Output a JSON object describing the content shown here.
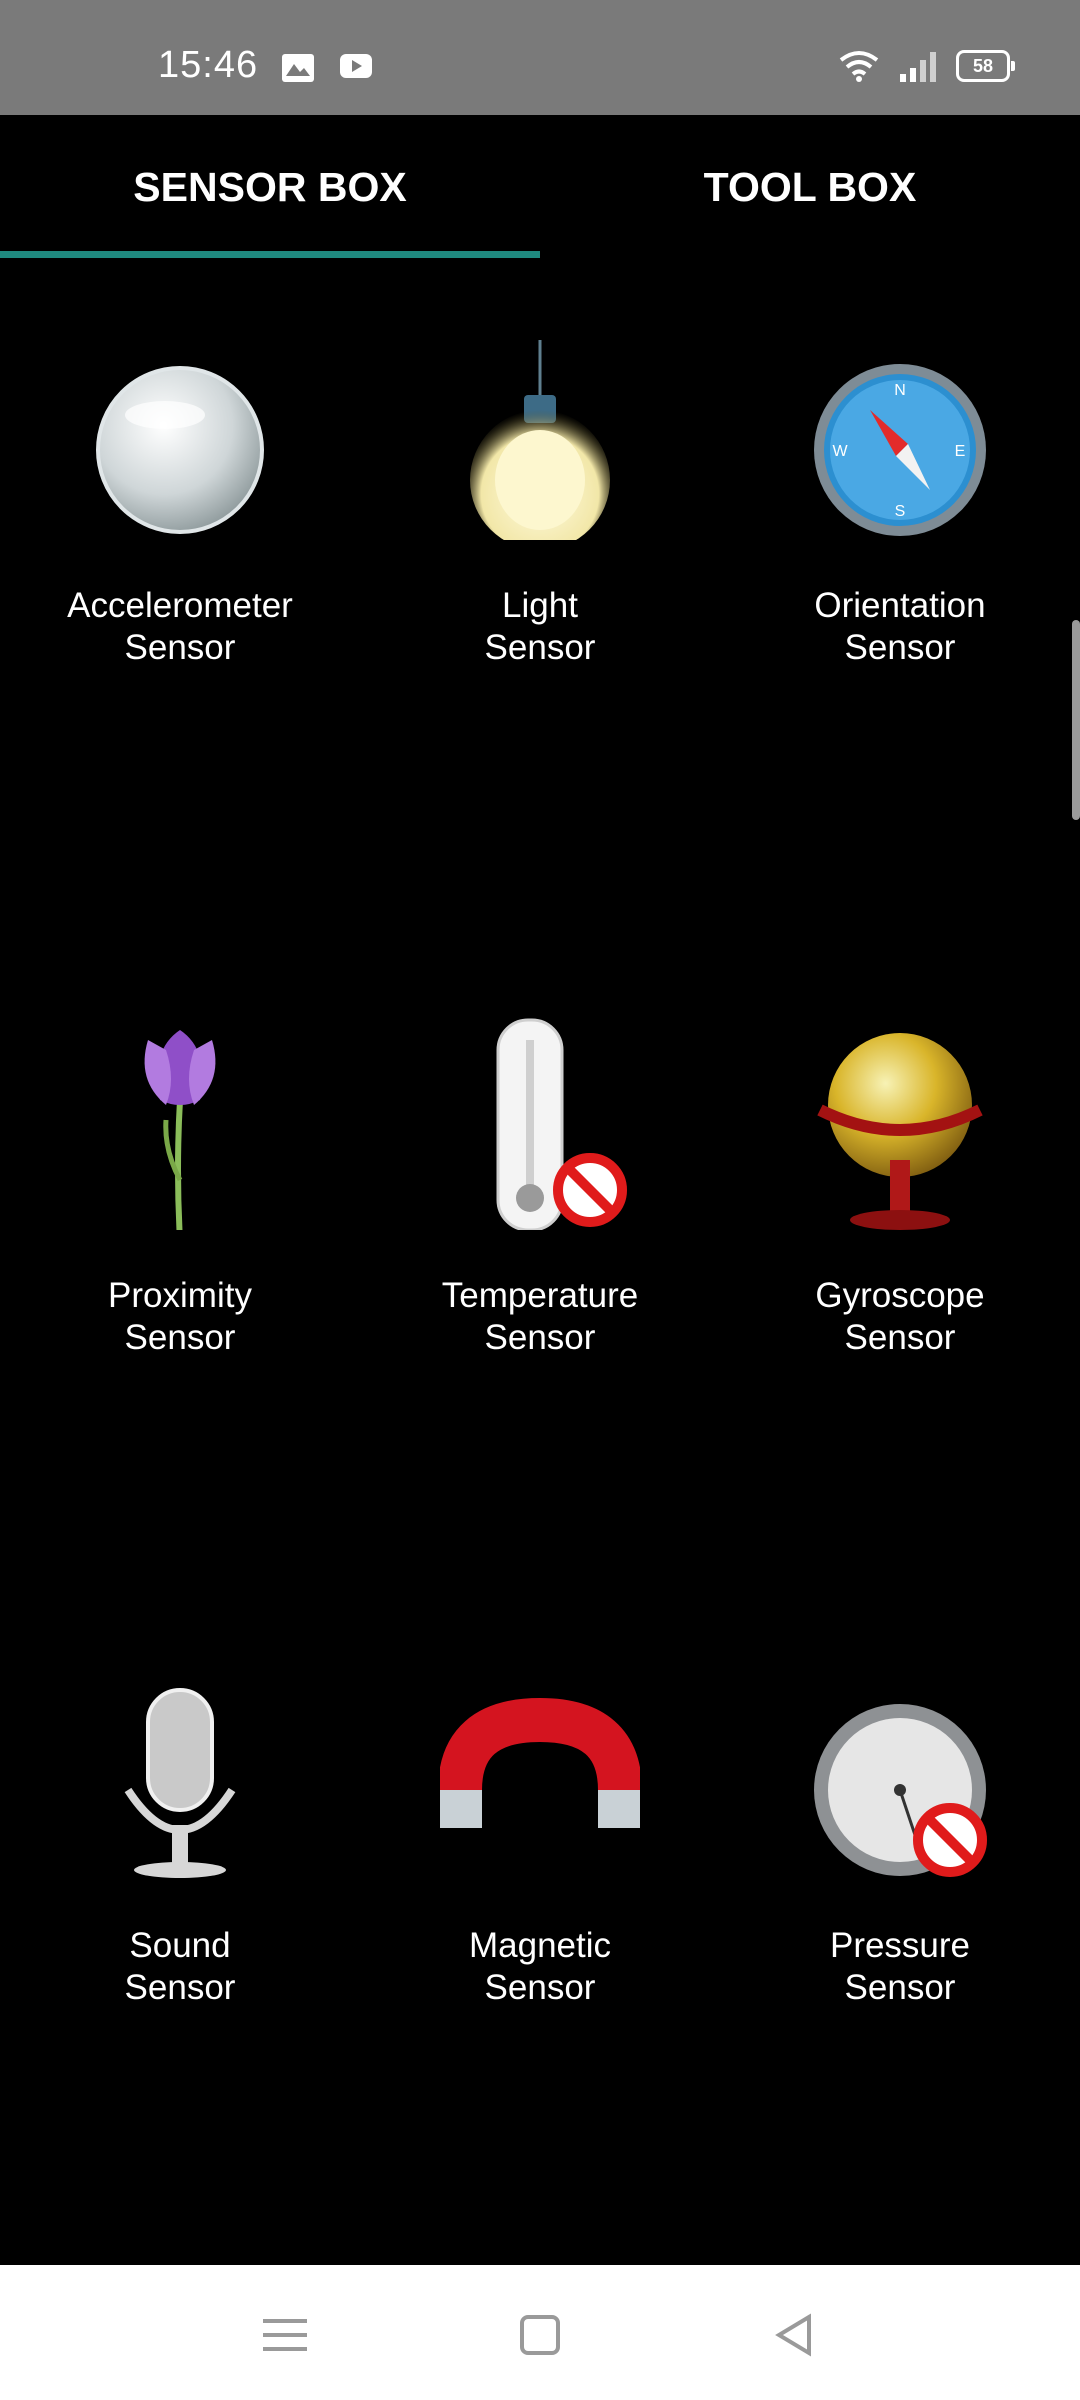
{
  "status_bar": {
    "time": "15:46",
    "left_icons": [
      "gallery-icon",
      "youtube-icon"
    ],
    "right_icons": [
      "wifi-icon",
      "signal-icon"
    ],
    "battery": "58"
  },
  "tabs": [
    {
      "label": "SENSOR BOX",
      "selected": true
    },
    {
      "label": "TOOL BOX",
      "selected": false
    }
  ],
  "accent_color": "#1f8a7f",
  "sensors": [
    {
      "label": "Accelerometer\nSensor",
      "icon": "bubble-icon"
    },
    {
      "label": "Light\nSensor",
      "icon": "lightbulb-icon"
    },
    {
      "label": "Orientation\nSensor",
      "icon": "compass-icon"
    },
    {
      "label": "Proximity\nSensor",
      "icon": "flower-icon"
    },
    {
      "label": "Temperature\nSensor",
      "icon": "thermometer-icon"
    },
    {
      "label": "Gyroscope\nSensor",
      "icon": "globe-icon"
    },
    {
      "label": "Sound\nSensor",
      "icon": "microphone-icon"
    },
    {
      "label": "Magnetic\nSensor",
      "icon": "magnet-icon"
    },
    {
      "label": "Pressure\nSensor",
      "icon": "barometer-icon"
    }
  ],
  "nav": {
    "buttons": [
      "menu-icon",
      "home-icon",
      "back-icon"
    ]
  }
}
